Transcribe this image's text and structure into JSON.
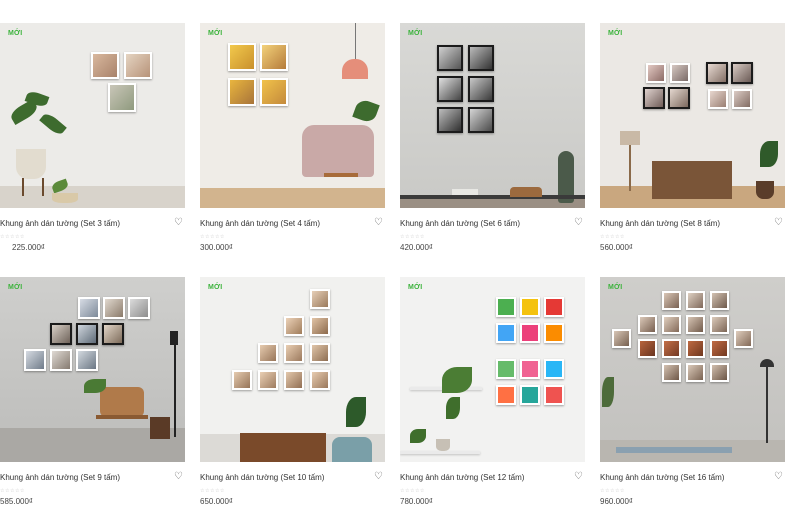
{
  "products": [
    {
      "badge": "MỚI",
      "title": "Khung ảnh dán tường (Set 3 tấm)",
      "price": "225.000₫",
      "stars": "☆☆☆☆☆"
    },
    {
      "badge": "MỚI",
      "title": "Khung ảnh dán tường (Set 4 tấm)",
      "price": "300.000₫",
      "stars": "☆☆☆☆☆"
    },
    {
      "badge": "MỚI",
      "title": "Khung ảnh dán tường (Set 6 tấm)",
      "price": "420.000₫",
      "stars": "☆☆☆☆☆"
    },
    {
      "badge": "MỚI",
      "title": "Khung ảnh dán tường (Set 8 tấm)",
      "price": "560.000₫",
      "stars": "☆☆☆☆☆"
    },
    {
      "badge": "MỚI",
      "title": "Khung ảnh dán tường (Set 9 tấm)",
      "price": "585.000₫",
      "stars": "☆☆☆☆☆"
    },
    {
      "badge": "MỚI",
      "title": "Khung ảnh dán tường (Set 10 tấm)",
      "price": "650.000₫",
      "stars": "☆☆☆☆☆"
    },
    {
      "badge": "MỚI",
      "title": "Khung ảnh dán tường (Set 12 tấm)",
      "price": "780.000₫",
      "stars": "☆☆☆☆☆"
    },
    {
      "badge": "MỚI",
      "title": "Khung ảnh dán tường (Set 16 tấm)",
      "price": "960.000₫",
      "stars": "☆☆☆☆☆"
    }
  ],
  "icons": {
    "wishlist": "heart-outline-icon"
  },
  "colors": {
    "badge": "#3cb33c",
    "text": "#333333",
    "price": "#444444"
  }
}
